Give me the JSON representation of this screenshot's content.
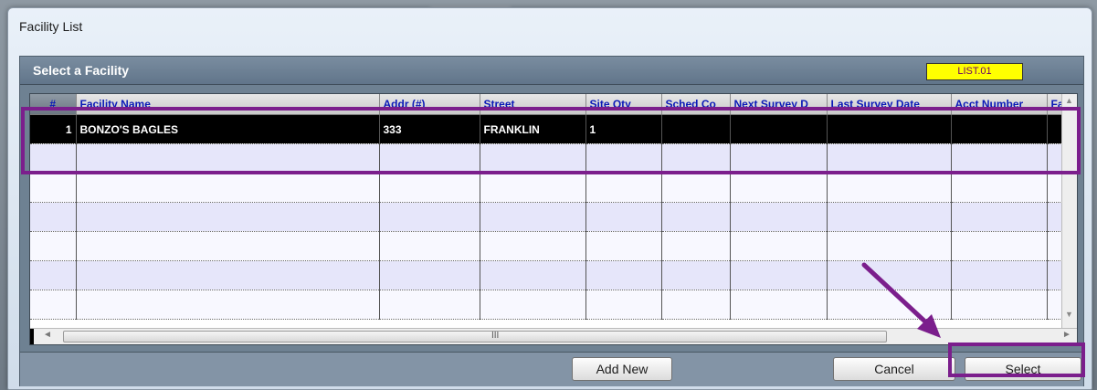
{
  "window": {
    "title": "Facility List"
  },
  "header": {
    "title": "Select a Facility",
    "list_code": "LIST.01"
  },
  "table": {
    "columns": [
      "#",
      "Facility Name",
      "Addr (#)",
      "Street",
      "Site Qty",
      "Sched Co",
      "Next Survey D",
      "Last Survey Date",
      "Acct Number",
      "Fa"
    ],
    "rows": [
      [
        "1",
        "BONZO'S BAGLES",
        "333",
        "FRANKLIN",
        "1",
        "",
        "",
        "",
        "",
        ""
      ]
    ]
  },
  "scrollbar": {
    "grip": "III"
  },
  "buttons": {
    "add_new": "Add New",
    "cancel": "Cancel",
    "select": "Select"
  },
  "colors": {
    "annotation": "#7b1e8c",
    "list_code_bg": "#ffff00",
    "header_bg": "#6e8192"
  }
}
